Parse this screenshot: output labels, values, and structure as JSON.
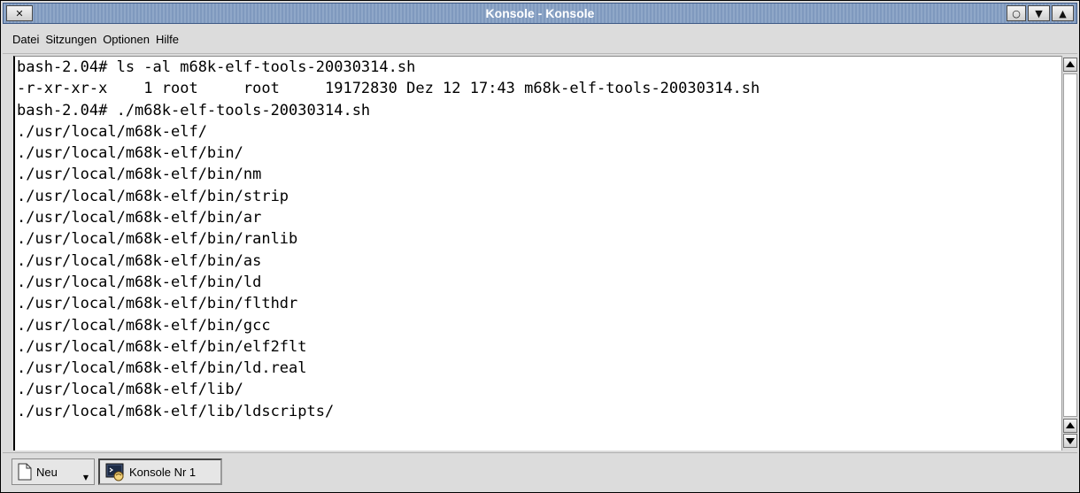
{
  "window": {
    "title": "Konsole - Konsole",
    "buttons": {
      "close": "✕",
      "shade": "○",
      "maximize": "▼",
      "minimize": "▲"
    }
  },
  "menu": {
    "items": [
      "Datei",
      "Sitzungen",
      "Optionen",
      "Hilfe"
    ]
  },
  "terminal": {
    "lines": [
      "bash-2.04# ls -al m68k-elf-tools-20030314.sh",
      "-r-xr-xr-x    1 root     root     19172830 Dez 12 17:43 m68k-elf-tools-20030314.sh",
      "bash-2.04# ./m68k-elf-tools-20030314.sh",
      "./usr/local/m68k-elf/",
      "./usr/local/m68k-elf/bin/",
      "./usr/local/m68k-elf/bin/nm",
      "./usr/local/m68k-elf/bin/strip",
      "./usr/local/m68k-elf/bin/ar",
      "./usr/local/m68k-elf/bin/ranlib",
      "./usr/local/m68k-elf/bin/as",
      "./usr/local/m68k-elf/bin/ld",
      "./usr/local/m68k-elf/bin/flthdr",
      "./usr/local/m68k-elf/bin/gcc",
      "./usr/local/m68k-elf/bin/elf2flt",
      "./usr/local/m68k-elf/bin/ld.real",
      "./usr/local/m68k-elf/lib/",
      "./usr/local/m68k-elf/lib/ldscripts/"
    ]
  },
  "tabs": {
    "new_label": "Neu",
    "session_label": "Konsole Nr 1"
  },
  "colors": {
    "titlebar": "#8fa7c8",
    "chrome": "#dcdcdc",
    "terminal_bg": "#ffffff",
    "terminal_fg": "#000000"
  }
}
